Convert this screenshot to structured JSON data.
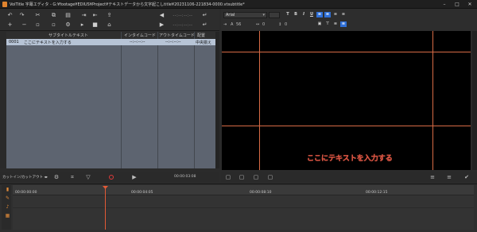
{
  "window": {
    "title": "VoiTitle 字幕エディタ - G:¥footage¥EDIUS¥Project¥テキストデータから文字起こしtitle¥20231106-221834-0000.vtsubtitle*",
    "minimize": "–",
    "maximize": "□",
    "close": "✕"
  },
  "left_toolbar": {
    "in_timecode": "--:--:--:--",
    "out_timecode": "--:--:--:--"
  },
  "grid": {
    "headers": {
      "index": "",
      "subtitle": "サブタイトルテキスト",
      "in": "インタイムコード",
      "out": "アウトタイムコード",
      "align": "配置"
    },
    "rows": [
      {
        "index": "0001",
        "subtitle": "ここにテキストを入力する",
        "in": "--:--:--:--",
        "out": "--:--:--:--",
        "align": "中央揃え"
      }
    ]
  },
  "right_toolbar": {
    "font": "Arial",
    "size_value": "56",
    "spacing_value": "0",
    "line_value": "0"
  },
  "preview": {
    "caption": "ここにテキストを入力する"
  },
  "controls": {
    "mode": "カットイン/カットアウト",
    "timecode": "00:00:03:08"
  },
  "timeline": {
    "labels": [
      "00:00:00:00",
      "00:00:04:05",
      "00:00:08:10",
      "00:00:12:15"
    ]
  },
  "colors": {
    "accent": "#e0832e",
    "guide": "#d86b45",
    "selection": "#b7c4d6",
    "record": "#e03a3a"
  }
}
